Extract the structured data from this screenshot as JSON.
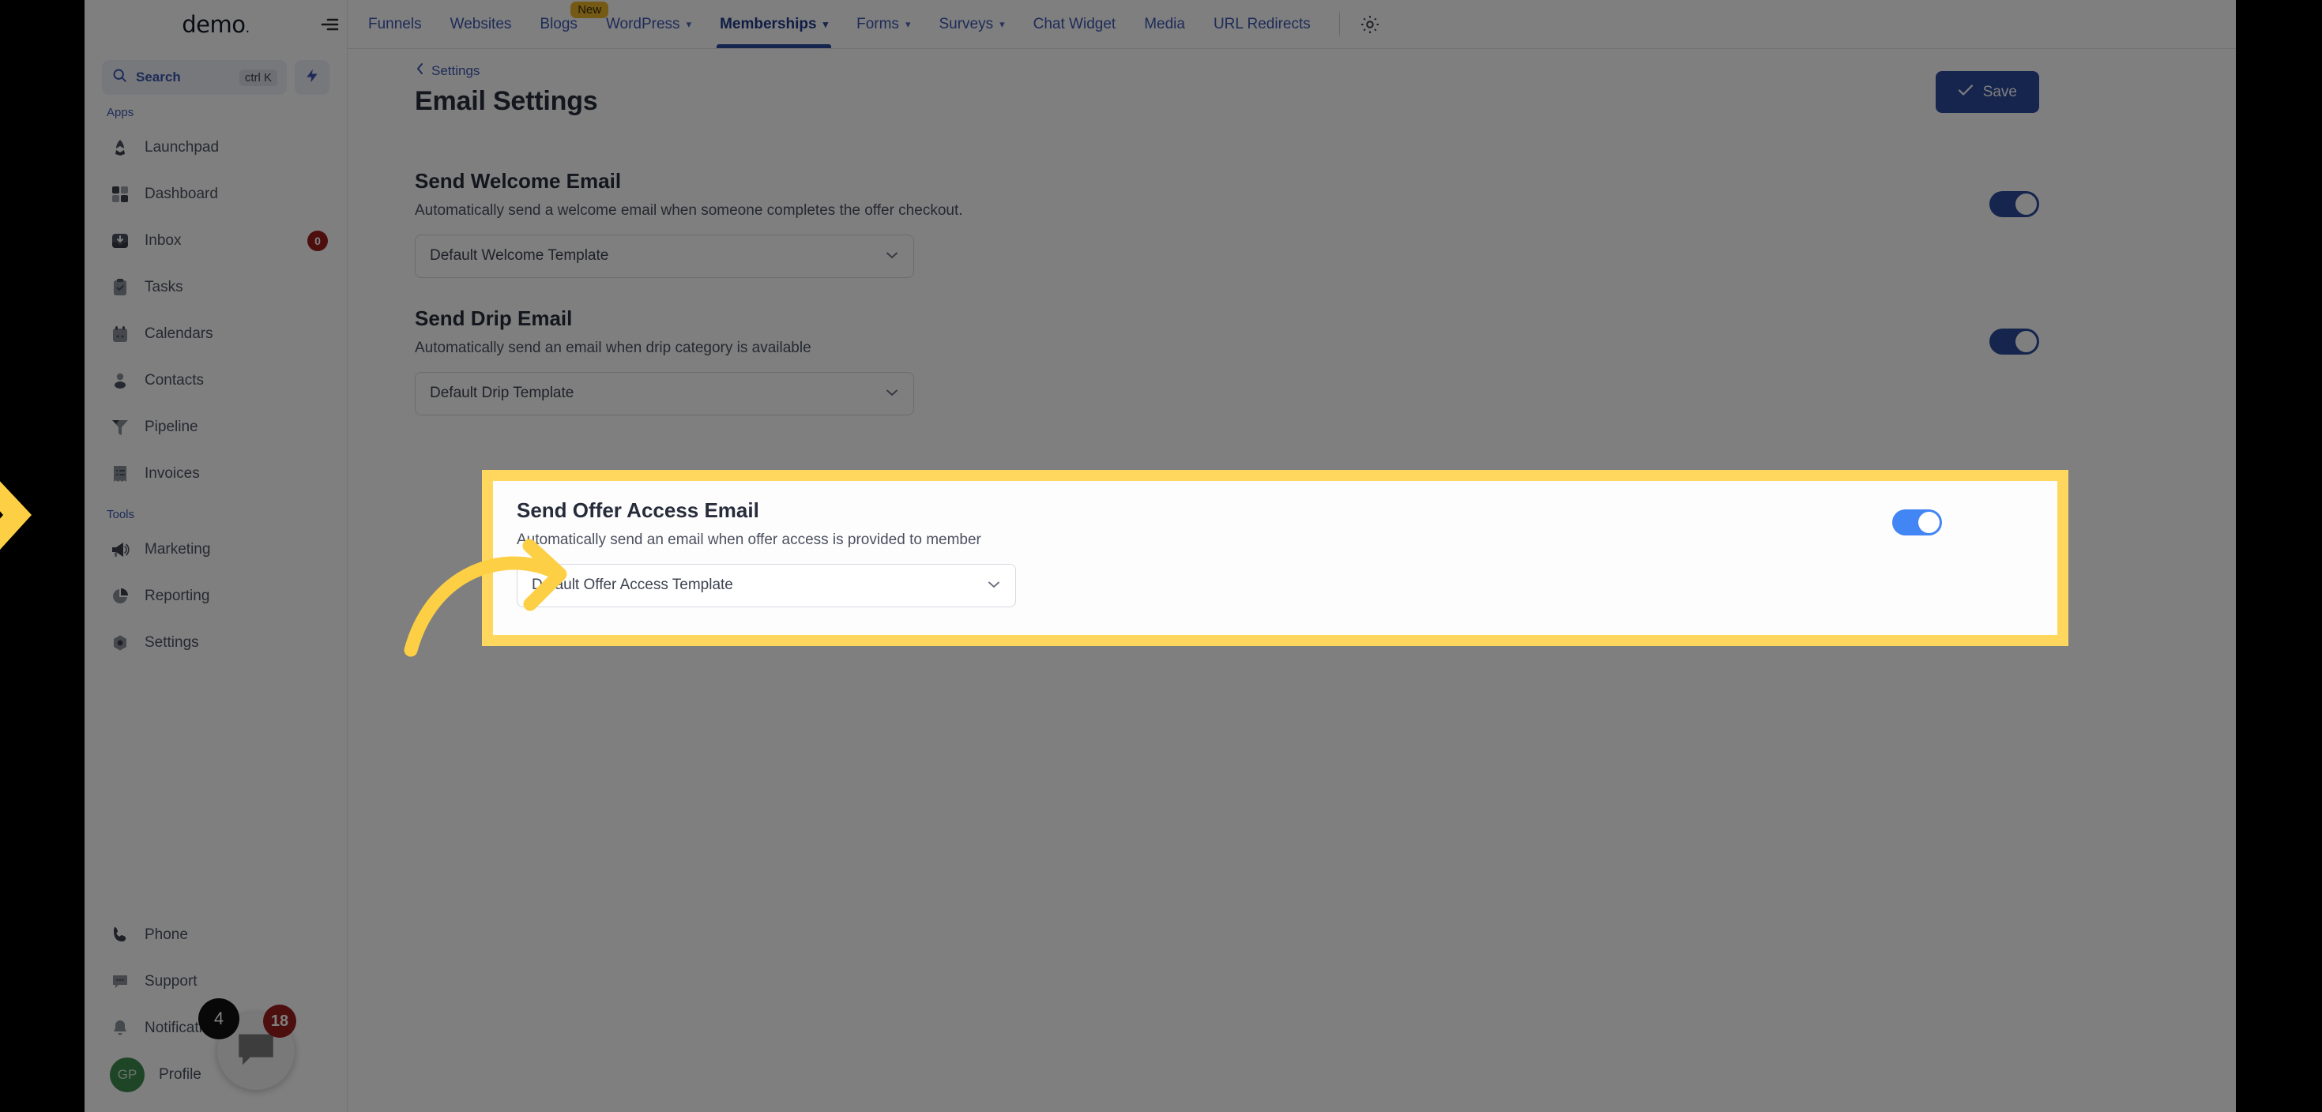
{
  "brand": {
    "name": "demo",
    "dot": "."
  },
  "search": {
    "label": "Search",
    "shortcut": "ctrl K"
  },
  "sidebar": {
    "sections": [
      {
        "label": "Apps",
        "items": [
          {
            "label": "Launchpad",
            "icon": "rocket-icon",
            "badge": ""
          },
          {
            "label": "Dashboard",
            "icon": "grid-icon",
            "badge": ""
          },
          {
            "label": "Inbox",
            "icon": "inbox-icon",
            "badge": "0"
          },
          {
            "label": "Tasks",
            "icon": "clipboard-check-icon",
            "badge": ""
          },
          {
            "label": "Calendars",
            "icon": "calendar-icon",
            "badge": ""
          },
          {
            "label": "Contacts",
            "icon": "person-icon",
            "badge": ""
          },
          {
            "label": "Pipeline",
            "icon": "funnel-icon",
            "badge": ""
          },
          {
            "label": "Invoices",
            "icon": "invoice-icon",
            "badge": ""
          }
        ]
      },
      {
        "label": "Tools",
        "items": [
          {
            "label": "Marketing",
            "icon": "megaphone-icon",
            "badge": ""
          },
          {
            "label": "Reporting",
            "icon": "pie-chart-icon",
            "badge": ""
          },
          {
            "label": "Settings",
            "icon": "gear-icon",
            "badge": ""
          }
        ]
      }
    ],
    "bottom_items": [
      {
        "label": "Phone",
        "icon": "phone-icon",
        "badge": ""
      },
      {
        "label": "Support",
        "icon": "chat-dots-icon",
        "badge": ""
      },
      {
        "label": "Notifications",
        "icon": "bell-icon",
        "badge": "18"
      },
      {
        "label": "Profile",
        "icon": "avatar",
        "badge": ""
      }
    ],
    "avatar_initials": "GP"
  },
  "chat_widget": {
    "unread": "4",
    "icon": "chat-bubble-icon"
  },
  "topnav": {
    "collapse_icon": "collapse-menu-icon",
    "tabs": [
      {
        "label": "Funnels",
        "caret": false,
        "active": false,
        "pill": ""
      },
      {
        "label": "Websites",
        "caret": false,
        "active": false,
        "pill": ""
      },
      {
        "label": "Blogs",
        "caret": false,
        "active": false,
        "pill": "New"
      },
      {
        "label": "WordPress",
        "caret": true,
        "active": false,
        "pill": ""
      },
      {
        "label": "Memberships",
        "caret": true,
        "active": true,
        "pill": ""
      },
      {
        "label": "Forms",
        "caret": true,
        "active": false,
        "pill": ""
      },
      {
        "label": "Surveys",
        "caret": true,
        "active": false,
        "pill": ""
      },
      {
        "label": "Chat Widget",
        "caret": false,
        "active": false,
        "pill": ""
      },
      {
        "label": "Media",
        "caret": false,
        "active": false,
        "pill": ""
      },
      {
        "label": "URL Redirects",
        "caret": false,
        "active": false,
        "pill": ""
      }
    ],
    "gear_icon": "gear-icon"
  },
  "page": {
    "breadcrumb": "Settings",
    "title": "Email Settings",
    "save_label": "Save",
    "save_icon": "check-icon"
  },
  "settings": [
    {
      "title": "Send Welcome Email",
      "desc": "Automatically send a welcome email when someone completes the offer checkout.",
      "select_value": "Default Welcome Template",
      "toggle_on": true,
      "highlighted": false
    },
    {
      "title": "Send Drip Email",
      "desc": "Automatically send an email when drip category is available",
      "select_value": "Default Drip Template",
      "toggle_on": true,
      "highlighted": false
    },
    {
      "title": "Send Offer Access Email",
      "desc": "Automatically send an email when offer access is provided to member",
      "select_value": "Default Offer Access Template",
      "toggle_on": true,
      "highlighted": true
    }
  ],
  "annotation": {
    "arrow_color": "#FDCF44",
    "highlight_border_color": "#FFD75E",
    "left_chevron_color": "#FDCF44"
  },
  "colors": {
    "brand_blue": "#2a4a9c",
    "link_blue": "#3b57b0",
    "toggle_on_active": "#4285f4",
    "badge_red": "#9b1c1c",
    "avatar_green": "#3f8a4e",
    "highlight_yellow": "#ffd75e"
  }
}
